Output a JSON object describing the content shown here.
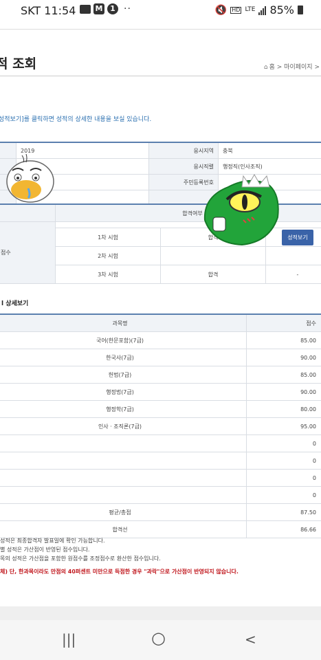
{
  "status": {
    "carrier_time": "SKT 11:54",
    "badge_m": "M",
    "badge_count": "1",
    "dots": "··",
    "lte": "LTE",
    "hd": "HD",
    "battery": "85%"
  },
  "header": {
    "title": "적 조회",
    "breadcrumb": "홈 > 마이페이지 >"
  },
  "guide_text": "성적보기]를 클릭하면 성적의 상세한 내용을 보실 있습니다.",
  "info": {
    "year": "2019",
    "region_label": "응시지역",
    "region_value": "충북",
    "position_label": "응시직렬",
    "position_value": "행정직(인사조직)",
    "reg_label": "주민등록번호",
    "reg_value": ""
  },
  "pass": {
    "header": "합격여부",
    "row_label": "점수",
    "rows": [
      {
        "exam": "1차 시험",
        "result": "합격",
        "action": "성적보기"
      },
      {
        "exam": "2차 시험",
        "result": "",
        "action": ""
      },
      {
        "exam": "3차 시험",
        "result": "합격",
        "action": "-"
      }
    ]
  },
  "detail": {
    "title": "l 상세보기",
    "col_subject": "과목명",
    "col_score": "점수",
    "rows": [
      {
        "subject": "국어(한문포함)(7급)",
        "score": "85.00"
      },
      {
        "subject": "한국사(7급)",
        "score": "90.00"
      },
      {
        "subject": "헌법(7급)",
        "score": "85.00"
      },
      {
        "subject": "행정법(7급)",
        "score": "90.00"
      },
      {
        "subject": "행정학(7급)",
        "score": "80.00"
      },
      {
        "subject": "인사 · 조직론(7급)",
        "score": "95.00"
      },
      {
        "subject": "",
        "score": "0"
      },
      {
        "subject": "",
        "score": "0"
      },
      {
        "subject": "",
        "score": "0"
      },
      {
        "subject": "",
        "score": "0"
      },
      {
        "subject": "평균/총점",
        "score": "87.50"
      },
      {
        "subject": "합격선",
        "score": "86.66"
      }
    ]
  },
  "notes": {
    "n1": "성적은 최종합격자 발표일에 확인 가능합니다.",
    "n2": "별 성적은 가산점이 반영된 점수입니다.",
    "n3": "목의 성적은 가산점을 포함한 원점수를 조정점수로 환산한 점수입니다.",
    "red": "체) 단, 한과목이라도 만점의 40퍼센트 미만으로 득점한 경우 \"과락\"으로 가산점이 반영되지 않습니다."
  },
  "nav": {
    "recent": "|||",
    "home": "○",
    "back": "<"
  }
}
